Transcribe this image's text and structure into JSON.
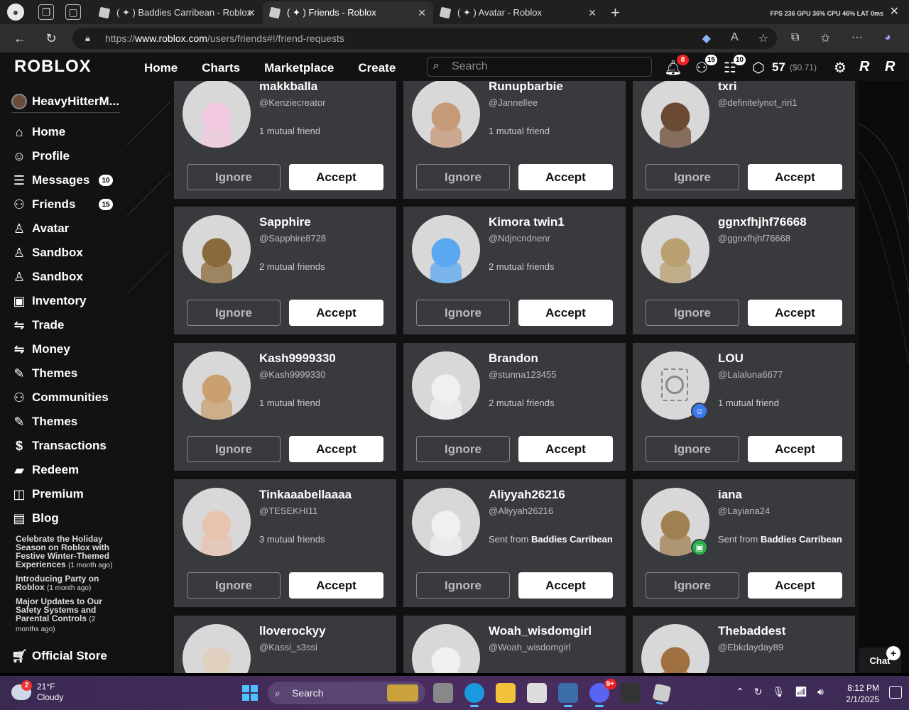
{
  "browser": {
    "tabs": [
      {
        "title": "( ✦ ) Baddies Carribean - Roblox"
      },
      {
        "title": "( ✦ ) Friends - Roblox"
      },
      {
        "title": "( ✦ ) Avatar - Roblox"
      }
    ],
    "stats": "FPS 236  GPU 36%  CPU 46%  LAT 0ms",
    "url_prefix": "https://",
    "url_host": "www.roblox.com",
    "url_path": "/users/friends#!/friend-requests"
  },
  "header": {
    "logo": "ROBLOX",
    "nav": [
      "Home",
      "Charts",
      "Marketplace",
      "Create"
    ],
    "search_placeholder": "Search",
    "notifications_count": "8",
    "friends_count": "15",
    "messages_count": "10",
    "robux": "57",
    "robux_usd": "($0.71)"
  },
  "sidebar": {
    "username": "HeavyHitterM...",
    "items": [
      {
        "label": "Home",
        "icon": "home-icon",
        "glyph": "⌂"
      },
      {
        "label": "Profile",
        "icon": "profile-icon",
        "glyph": "☺"
      },
      {
        "label": "Messages",
        "icon": "messages-icon",
        "glyph": "☰",
        "badge": "10"
      },
      {
        "label": "Friends",
        "icon": "friends-icon",
        "glyph": "⚇",
        "badge": "15"
      },
      {
        "label": "Avatar",
        "icon": "avatar-icon",
        "glyph": "♙"
      },
      {
        "label": "Sandbox",
        "icon": "sandbox-icon",
        "glyph": "♙"
      },
      {
        "label": "Sandbox",
        "icon": "sandbox-icon",
        "glyph": "♙"
      },
      {
        "label": "Inventory",
        "icon": "inventory-icon",
        "glyph": "▣"
      },
      {
        "label": "Trade",
        "icon": "trade-icon",
        "glyph": "⇋"
      },
      {
        "label": "Money",
        "icon": "money-icon",
        "glyph": "⇋"
      },
      {
        "label": "Themes",
        "icon": "themes-icon",
        "glyph": "✎"
      },
      {
        "label": "Communities",
        "icon": "communities-icon",
        "glyph": "⚇"
      },
      {
        "label": "Themes",
        "icon": "themes-icon",
        "glyph": "✎"
      },
      {
        "label": "Transactions",
        "icon": "transactions-icon",
        "glyph": "$"
      },
      {
        "label": "Redeem",
        "icon": "redeem-icon",
        "glyph": "▰"
      },
      {
        "label": "Premium",
        "icon": "premium-icon",
        "glyph": "◫"
      },
      {
        "label": "Blog",
        "icon": "blog-icon",
        "glyph": "▤"
      }
    ],
    "blog_posts": [
      {
        "title": "Celebrate the Holiday Season on Roblox with Festive Winter-Themed Experiences",
        "ago": "(1 month ago)"
      },
      {
        "title": "Introducing Party on Roblox",
        "ago": "(1 month ago)"
      },
      {
        "title": "Major Updates to Our Safety Systems and Parental Controls",
        "ago": "(2 months ago)"
      }
    ],
    "official_store": "Official Store"
  },
  "requests": {
    "ignore_label": "Ignore",
    "accept_label": "Accept",
    "sent_from_prefix": "Sent from",
    "cards": [
      {
        "name": "makkballa",
        "handle": "@Kenziecreator",
        "mutual": "1 mutual friend",
        "skin": "#f2c9e0"
      },
      {
        "name": "Runupbarbie",
        "handle": "@Jannellee",
        "mutual": "1 mutual friend",
        "skin": "#c59a78"
      },
      {
        "name": "txri",
        "handle": "@definitelynot_riri1",
        "mutual": "",
        "skin": "#6b4a34"
      },
      {
        "name": "Sapphire",
        "handle": "@Sapphire8728",
        "mutual": "2 mutual friends",
        "skin": "#8a6a3a"
      },
      {
        "name": "Kimora twin1",
        "handle": "@Ndjncndnenr",
        "mutual": "2 mutual friends",
        "skin": "#5aa8f0"
      },
      {
        "name": "ggnxfhjhf76668",
        "handle": "@ggnxfhjhf76668",
        "mutual": "",
        "skin": "#b8a070"
      },
      {
        "name": "Kash9999330",
        "handle": "@Kash9999330",
        "mutual": "1 mutual friend",
        "skin": "#caa070"
      },
      {
        "name": "Brandon",
        "handle": "@stunna123455",
        "mutual": "2 mutual friends",
        "skin": "#f0f0f0"
      },
      {
        "name": "LOU",
        "handle": "@Lalaluna6677",
        "mutual": "1 mutual friend",
        "skin": "#5a5a5e"
      },
      {
        "name": "Tinkaaabellaaaa",
        "handle": "@TESEKHI11",
        "mutual": "3 mutual friends",
        "skin": "#e8c4b0"
      },
      {
        "name": "Aliyyah26216",
        "handle": "@Aliyyah26216",
        "sent_from": "Baddies Carribean",
        "skin": "#f0f0f0"
      },
      {
        "name": "iana",
        "handle": "@Layiana24",
        "sent_from": "Baddies Carribean",
        "skin": "#a08050"
      },
      {
        "name": "lloverockyy",
        "handle": "@Kassi_s3ssi",
        "mutual": "",
        "skin": "#e0d0c0"
      },
      {
        "name": "Woah_wisdomgirl",
        "handle": "@Woah_wisdomgirl",
        "mutual": "",
        "skin": "#f0f0f0"
      },
      {
        "name": "Thebaddest",
        "handle": "@Ebkdayday89",
        "mutual": "",
        "skin": "#a07040"
      }
    ]
  },
  "chat": {
    "label": "Chat"
  },
  "taskbar": {
    "weather_badge": "2",
    "temp": "21°F",
    "condition": "Cloudy",
    "search_label": "Search",
    "discord_badge": "9+",
    "time": "8:12 PM",
    "date": "2/1/2025"
  },
  "colors": {
    "card_bg": "#393a3e",
    "accept_bg": "#ffffff",
    "header_bg": "#121215",
    "taskbar_bg": "#4a2c5e"
  }
}
